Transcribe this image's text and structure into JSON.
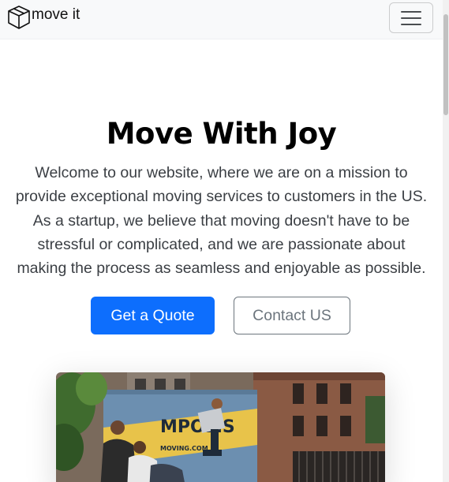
{
  "navbar": {
    "brand_text": "move it",
    "brand_icon": "box-icon",
    "toggler_icon": "hamburger-icon"
  },
  "hero": {
    "title": "Move With Joy",
    "lead": "Welcome to our website, where we are on a mission to provide exceptional moving services to customers in the US. As a startup, we believe that moving doesn't have to be stressful or complicated, and we are passionate about making the process as seamless and enjoyable as possible.",
    "primary_button": "Get a Quote",
    "secondary_button": "Contact US",
    "truck_text": "MPOLIS",
    "truck_subtext": "MOVING.COM"
  },
  "colors": {
    "primary": "#0d6efd",
    "outline": "#6c757d",
    "navbar_bg": "#f8f9fa"
  }
}
